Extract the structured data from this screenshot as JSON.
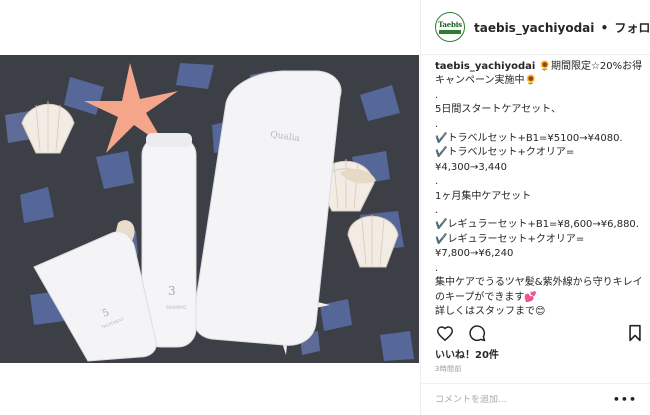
{
  "post": {
    "username": "taebis_yachiyodai",
    "separator": "•",
    "follow_label": "フォロー中",
    "avatar_logo_text": "Taebis",
    "caption_username": "taebis_yachiyodai",
    "caption_body": " 🌻期間限定☆20%お得キャンペーン実施中🌻\n.\n5日間スタートケアセット、\n.\n✔️トラベルセット+B1=¥5100→¥4080.\n✔️トラベルセット+クオリア=\n¥4,300→3,440\n.\n1ヶ月集中ケアセット\n.\n✔️レギュラーセット+B1=¥8,600→¥6,880.\n✔️レギュラーセット+クオリア=\n¥7,800→¥6,240\n.\n集中ケアでうるツヤ髪&紫外線から守りキレイのキープができます💕\n詳しくはスタッフまで😊\n.",
    "likes_text": "いいね！20件",
    "time_text": "3時間前",
    "comment_placeholder": "コメントを追加...",
    "more_icon_glyph": "•••"
  },
  "icons": {
    "like": "heart-icon",
    "comment": "comment-icon",
    "save": "bookmark-icon",
    "more": "more-options-icon"
  },
  "photo": {
    "products": [
      {
        "label_name": "5",
        "label_sub": "TREATMENT"
      },
      {
        "label_name": "3",
        "label_sub": "SHAMPOO"
      },
      {
        "label_name": "Qualia",
        "label_sub": "Qualia"
      }
    ],
    "colors": {
      "background": "#3d3f46",
      "glass": "#5a6fa8",
      "shell": "#f2ece4",
      "starfish": "#f4a58a",
      "bottle": "#f4f4f6"
    }
  },
  "colors": {
    "text": "#262626",
    "muted": "#999999",
    "divider": "#efefef",
    "brand_green": "#2e7d32"
  }
}
